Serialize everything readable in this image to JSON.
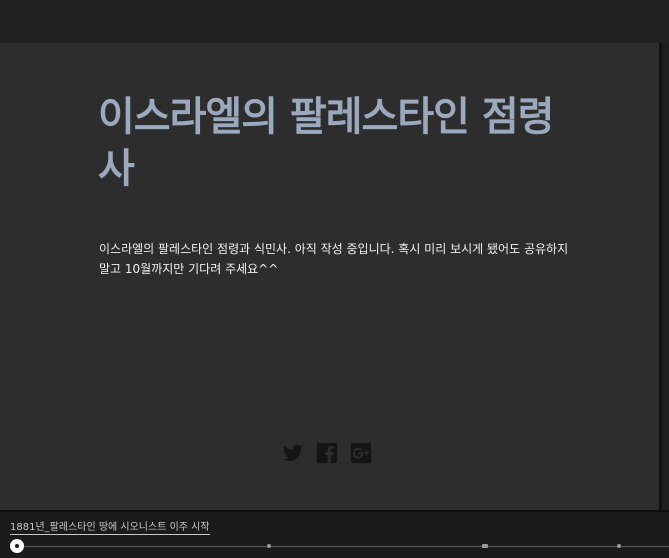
{
  "header": {
    "title": "이스라엘의 팔레스타인 점령사"
  },
  "main": {
    "description": "이스라엘의 팔레스타인 점령과 식민사. 아직 작성 중입니다. 혹시 미리 보시게 됐어도 공유하지 말고 10월까지만 기다려 주세요^^"
  },
  "share": {
    "icons": [
      "twitter-icon",
      "facebook-icon",
      "google-plus-icon"
    ]
  },
  "timeline": {
    "current_label": "1881년_팔레스타인 땅에 시오니스트 이주 시작",
    "marker_count": 3
  },
  "colors": {
    "title": "#9aa9bd",
    "background": "#2d2d2d",
    "text": "#f0f0f0"
  }
}
